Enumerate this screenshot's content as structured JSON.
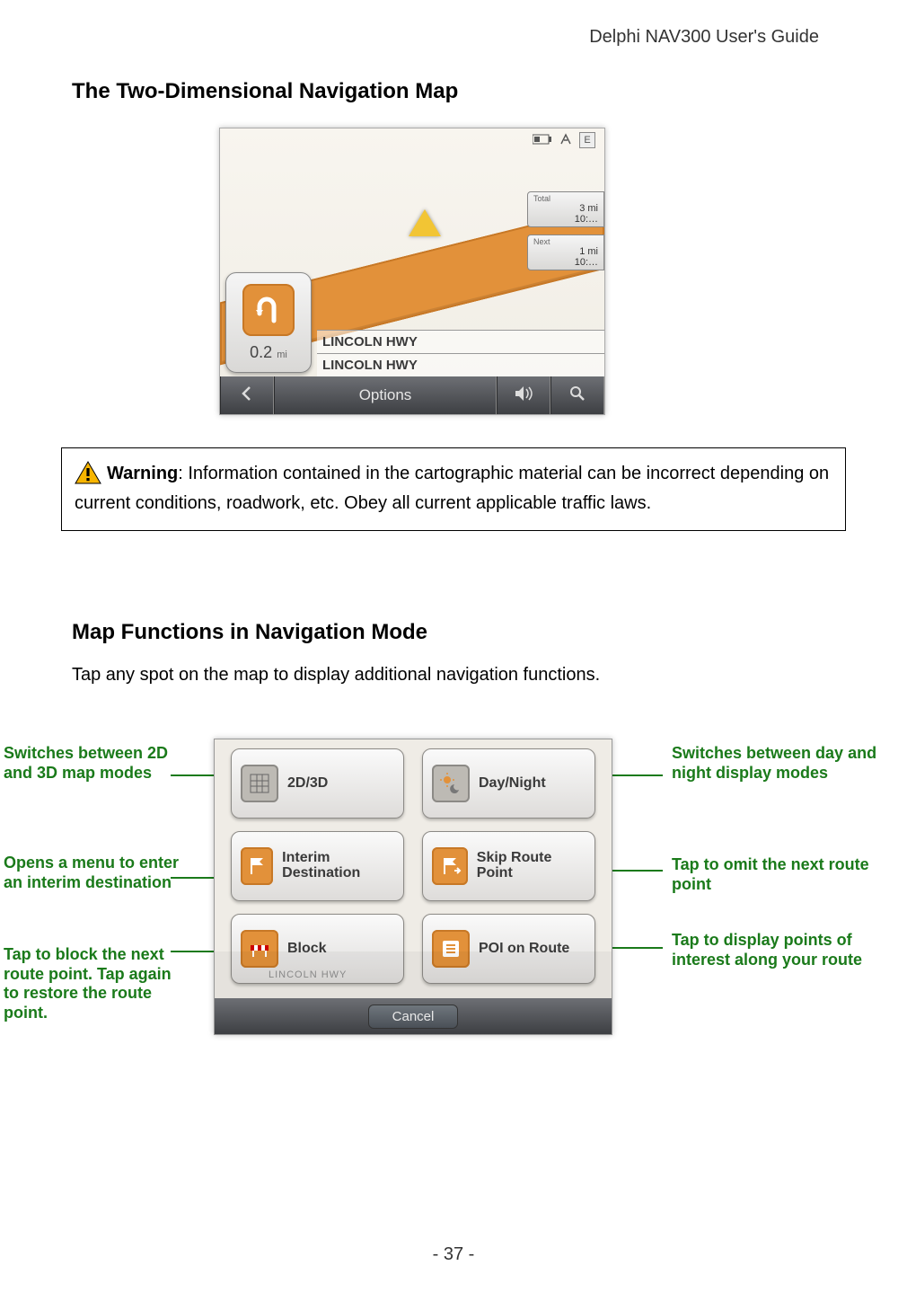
{
  "header": {
    "document_title": "Delphi NAV300 User's Guide"
  },
  "section1": {
    "heading": "The Two-Dimensional Navigation Map"
  },
  "shot1": {
    "status": {
      "compass": "E"
    },
    "info": {
      "total_label": "Total",
      "total_dist": "3 mi",
      "total_time": "10:…",
      "next_label": "Next",
      "next_dist": "1 mi",
      "next_time": "10:…"
    },
    "turn": {
      "distance": "0.2",
      "unit": "mi"
    },
    "roads": {
      "upper": "LINCOLN HWY",
      "lower": "LINCOLN HWY"
    },
    "bottombar": {
      "options": "Options"
    }
  },
  "warning": {
    "label": "Warning",
    "text": ": Information contained in the cartographic material can be incorrect depending on current conditions, roadwork, etc.  Obey all current applicable traffic laws."
  },
  "section2": {
    "heading": "Map Functions in Navigation Mode",
    "body": "Tap any spot on the map to display additional navigation functions."
  },
  "shot2": {
    "buttons": {
      "b2d3d": "2D/3D",
      "daynight": "Day/Night",
      "interimdest": "Interim Destination",
      "skiproute": "Skip Route Point",
      "block": "Block",
      "poi": "POI on Route"
    },
    "ghost": "LINCOLN HWY",
    "cancel": "Cancel"
  },
  "callouts": {
    "c_2d3d": "Switches between 2D and 3D map modes",
    "c_interim": "Opens a menu to enter an interim destination",
    "c_block": "Tap to block the next route point.  Tap again to restore the route point.",
    "c_daynight": "Switches between day and night display modes",
    "c_skip": "Tap to omit the next route point",
    "c_poi": "Tap to display points of interest along your route"
  },
  "footer": {
    "page": "- 37 -"
  }
}
